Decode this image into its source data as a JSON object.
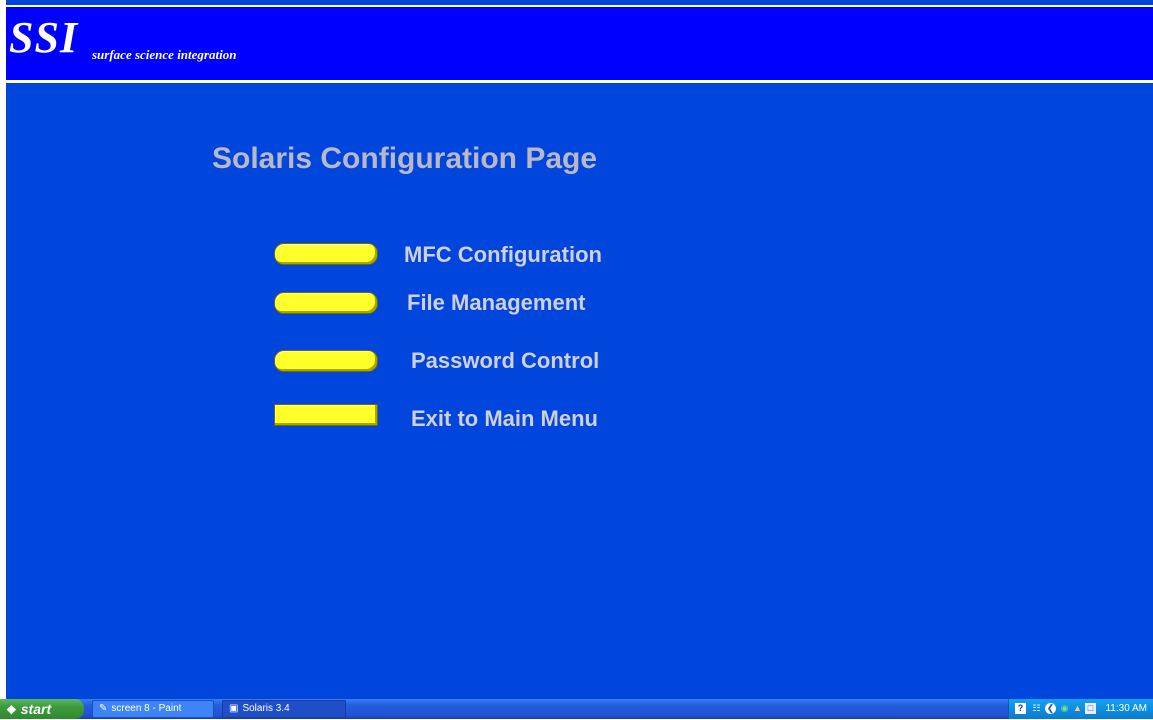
{
  "header": {
    "logo_mark": "SSI",
    "tagline": "surface science integration"
  },
  "page_title": "Solaris Configuration Page",
  "menu": [
    {
      "label": "MFC Configuration"
    },
    {
      "label": "File Management"
    },
    {
      "label": "Password Control"
    },
    {
      "label": "Exit to Main Menu"
    }
  ],
  "taskbar": {
    "start_label": "start",
    "items": [
      {
        "label": "screen 8 - Paint",
        "icon": "paint-icon"
      },
      {
        "label": "Solaris 3.4",
        "icon": "solaris-icon"
      }
    ],
    "clock": "11:30 AM",
    "tray_icons": [
      "help-icon",
      "network-icon",
      "security-icon",
      "updates-icon",
      "volume-icon",
      "display-icon"
    ]
  },
  "colors": {
    "background": "#0045dc",
    "header": "#0000ff",
    "button": "#ffff2a",
    "label": "#d0d0dc",
    "title": "#b8b8c8"
  }
}
